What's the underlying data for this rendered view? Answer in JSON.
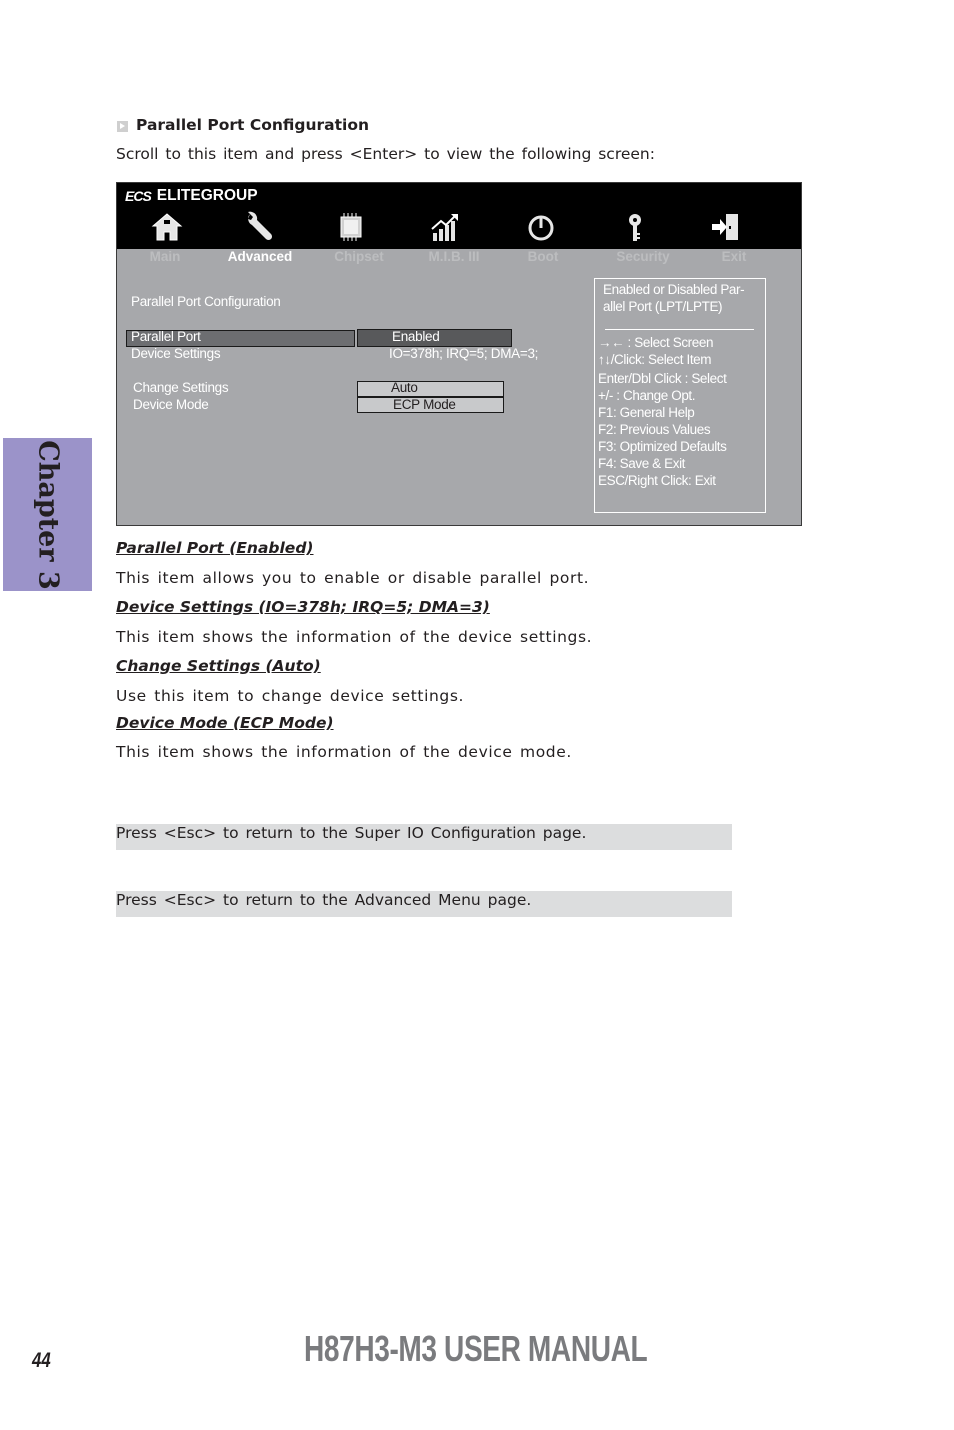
{
  "section": {
    "title": "Parallel Port Configuration",
    "intro": "Scroll to this item and press <Enter> to view the following screen:"
  },
  "bios": {
    "brand_logo": "ECS",
    "brand_name": "ELITEGROUP",
    "tabs": [
      {
        "label": "Main",
        "icon": "home-icon",
        "active": false
      },
      {
        "label": "Advanced",
        "icon": "wrench-icon",
        "active": true
      },
      {
        "label": "Chipset",
        "icon": "chip-icon",
        "active": false
      },
      {
        "label": "M.I.B. III",
        "icon": "chart-growth-icon",
        "active": false
      },
      {
        "label": "Boot",
        "icon": "power-icon",
        "active": false
      },
      {
        "label": "Security",
        "icon": "key-icon",
        "active": false
      },
      {
        "label": "Exit",
        "icon": "exit-door-icon",
        "active": false
      }
    ],
    "page_heading": "Parallel Port Configuration",
    "items": [
      {
        "label": "Parallel Port",
        "value": "Enabled"
      },
      {
        "label": "Device Settings",
        "value": "IO=378h; IRQ=5; DMA=3;"
      },
      {
        "label": "Change Settings",
        "value": "Auto"
      },
      {
        "label": "Device Mode",
        "value": "ECP Mode"
      }
    ],
    "help": {
      "description_line1": "Enabled or Disabled Par-",
      "description_line2": "allel Port (LPT/LPTE)",
      "keys": [
        "→←   : Select Screen",
        "↑↓/Click: Select Item",
        "Enter/Dbl Click : Select",
        "+/- : Change Opt.",
        "F1: General Help",
        "F2: Previous Values",
        "F3: Optimized Defaults",
        "F4: Save & Exit",
        "ESC/Right Click: Exit"
      ]
    }
  },
  "descriptions": [
    {
      "heading": "Parallel Port (Enabled)",
      "text": "This item allows you to enable or disable parallel port."
    },
    {
      "heading": "Device Settings (IO=378h; IRQ=5; DMA=3)",
      "text": "This item shows the information of the device settings."
    },
    {
      "heading": "Change Settings (Auto)",
      "text": "Use this item to change device settings."
    },
    {
      "heading": "Device Mode (ECP Mode)",
      "text": "This item shows the information of the device mode."
    }
  ],
  "notes": [
    "Press <Esc> to return to the Super IO Configuration page.",
    "Press <Esc> to return to the Advanced Menu page."
  ],
  "chapter_tab": "Chapter 3",
  "footer": {
    "page_number": "44",
    "manual_title": "H87H3-M3 USER MANUAL"
  },
  "colors": {
    "chapter_tab": "#9b93c9",
    "bios_panel": "#a7a8ab",
    "bios_header": "#000000",
    "note_bg": "#dcddde",
    "manual_title": "#7a7b7e"
  }
}
